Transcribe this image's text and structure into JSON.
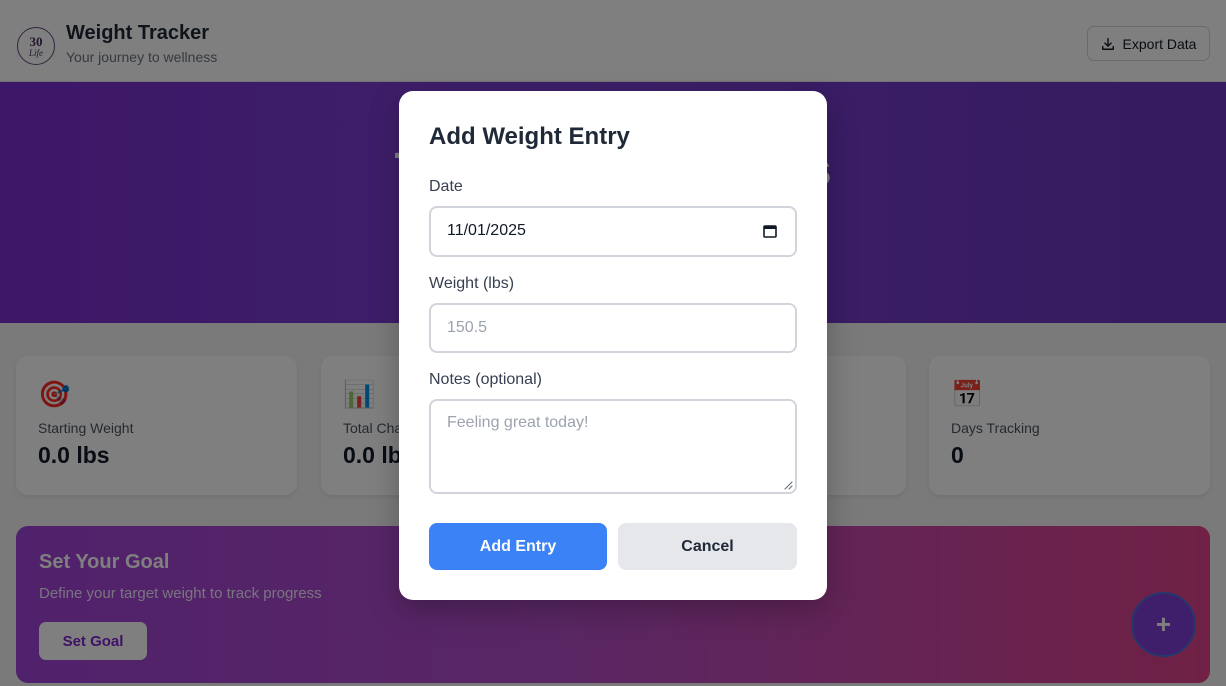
{
  "header": {
    "logo_text_top": "30",
    "logo_text_bottom": "Life",
    "title": "Weight Tracker",
    "subtitle": "Your journey to wellness",
    "export_label": "Export Data",
    "export_icon": "download-icon"
  },
  "hero": {
    "title_partial": "T                              s"
  },
  "stats": [
    {
      "icon": "🎯",
      "label": "Starting Weight",
      "value": "0.0 lbs"
    },
    {
      "icon": "📊",
      "label": "Total Cha",
      "value": "0.0 lb"
    },
    {
      "icon": "",
      "label": "",
      "value": ""
    },
    {
      "icon": "📅",
      "label": "Days Tracking",
      "value": "0"
    }
  ],
  "goal": {
    "title": "Set Your Goal",
    "description": "Define your target weight to track progress",
    "button_label": "Set Goal"
  },
  "fab": {
    "label": "+"
  },
  "modal": {
    "title": "Add Weight Entry",
    "date_label": "Date",
    "date_value": "11/01/2025",
    "weight_label": "Weight (lbs)",
    "weight_placeholder": "150.5",
    "notes_label": "Notes (optional)",
    "notes_placeholder": "Feeling great today!",
    "add_label": "Add Entry",
    "cancel_label": "Cancel"
  },
  "colors": {
    "hero": "#7a2fd0",
    "primary_button": "#3b82f6",
    "goal_gradient_start": "#a143d8",
    "goal_gradient_end": "#e0428a"
  }
}
